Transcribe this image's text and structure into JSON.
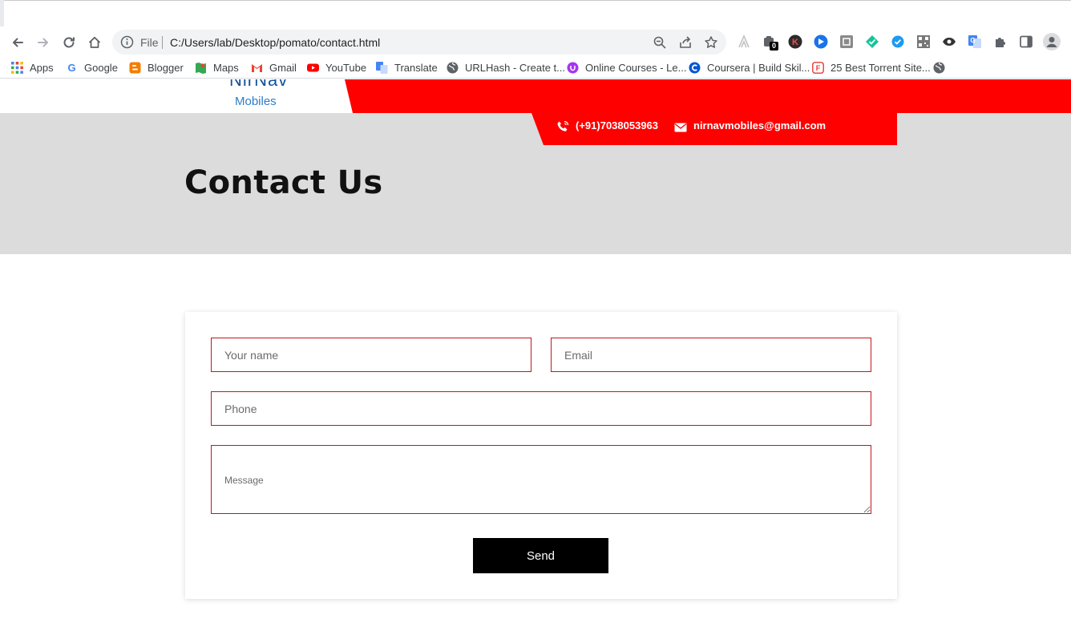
{
  "browser": {
    "file_label": "File",
    "url": "C:/Users/lab/Desktop/pomato/contact.html",
    "extension_badge": "0",
    "bookmarks": [
      {
        "label": "Apps",
        "icon": "apps-grid-icon"
      },
      {
        "label": "Google",
        "icon": "google-icon"
      },
      {
        "label": "Blogger",
        "icon": "blogger-icon"
      },
      {
        "label": "Maps",
        "icon": "maps-icon"
      },
      {
        "label": "Gmail",
        "icon": "gmail-icon"
      },
      {
        "label": "YouTube",
        "icon": "youtube-icon"
      },
      {
        "label": "Translate",
        "icon": "translate-icon"
      },
      {
        "label": "URLHash - Create t...",
        "icon": "globe-icon"
      },
      {
        "label": "Online Courses - Le...",
        "icon": "udemy-icon"
      },
      {
        "label": "Coursera | Build Skil...",
        "icon": "coursera-icon"
      },
      {
        "label": "25 Best Torrent Site...",
        "icon": "torrent-icon"
      },
      {
        "label": "",
        "icon": "globe-icon"
      }
    ]
  },
  "site": {
    "logo_top": "NirNav",
    "logo_sub": "Mobiles",
    "phone": "(+91)7038053963",
    "email": "nirnavmobiles@gmail.com",
    "page_title": "Contact Us"
  },
  "form": {
    "name_placeholder": "Your name",
    "email_placeholder": "Email",
    "phone_placeholder": "Phone",
    "message_placeholder": "Message",
    "send_label": "Send"
  },
  "colors": {
    "accent": "#ff0000",
    "field_border": "#c4161c",
    "hero_bg": "#dcdcdc",
    "button_bg": "#000000"
  }
}
